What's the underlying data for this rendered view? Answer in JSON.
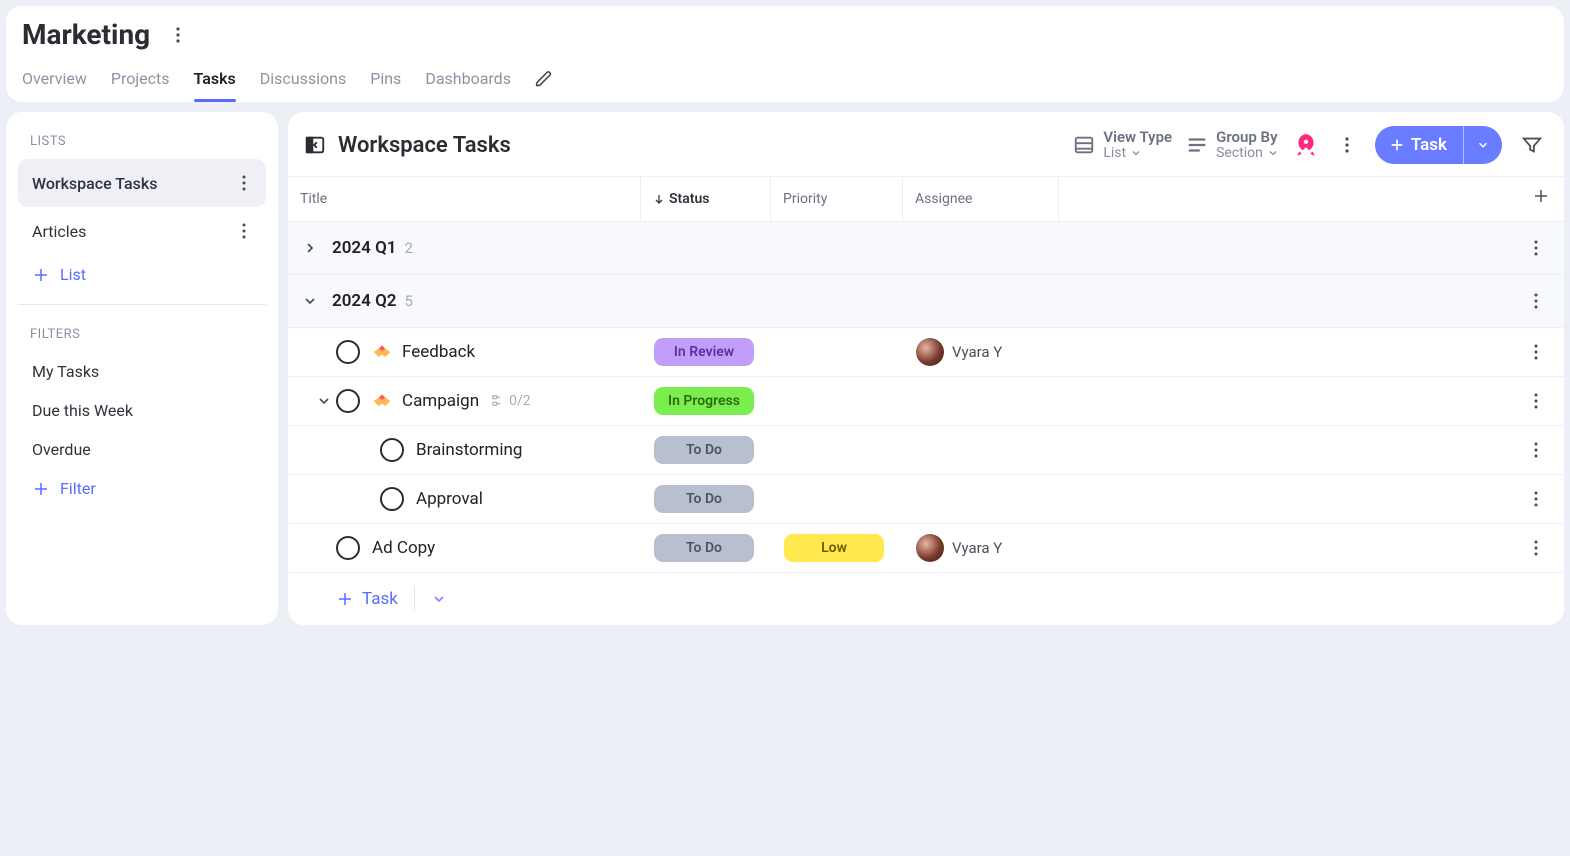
{
  "header": {
    "title": "Marketing",
    "tabs": [
      {
        "label": "Overview",
        "active": false
      },
      {
        "label": "Projects",
        "active": false
      },
      {
        "label": "Tasks",
        "active": true
      },
      {
        "label": "Discussions",
        "active": false
      },
      {
        "label": "Pins",
        "active": false
      },
      {
        "label": "Dashboards",
        "active": false
      }
    ]
  },
  "sidebar": {
    "lists_label": "LISTS",
    "lists": [
      {
        "label": "Workspace Tasks",
        "active": true
      },
      {
        "label": "Articles",
        "active": false
      }
    ],
    "add_list_label": "List",
    "filters_label": "FILTERS",
    "filters": [
      {
        "label": "My Tasks"
      },
      {
        "label": "Due this Week"
      },
      {
        "label": "Overdue"
      }
    ],
    "add_filter_label": "Filter"
  },
  "main": {
    "title": "Workspace Tasks",
    "view_type": {
      "label": "View Type",
      "value": "List"
    },
    "group_by": {
      "label": "Group By",
      "value": "Section"
    },
    "task_button_label": "Task",
    "columns": {
      "title": "Title",
      "status": "Status",
      "priority": "Priority",
      "assignee": "Assignee"
    },
    "sections": [
      {
        "title": "2024 Q1",
        "count": "2",
        "expanded": false
      },
      {
        "title": "2024 Q2",
        "count": "5",
        "expanded": true
      }
    ],
    "tasks": [
      {
        "title": "Feedback",
        "status": "In Review",
        "status_class": "in-review",
        "priority": "",
        "assignee": "Vyara Y",
        "has_emoji": true
      },
      {
        "title": "Campaign",
        "status": "In Progress",
        "status_class": "in-progress",
        "priority": "",
        "assignee": "",
        "has_emoji": true,
        "subtasks_ind": "0/2",
        "expanded": true
      },
      {
        "title": "Brainstorming",
        "status": "To Do",
        "status_class": "todo",
        "priority": "",
        "assignee": "",
        "subtask": true
      },
      {
        "title": "Approval",
        "status": "To Do",
        "status_class": "todo",
        "priority": "",
        "assignee": "",
        "subtask": true
      },
      {
        "title": "Ad Copy",
        "status": "To Do",
        "status_class": "todo",
        "priority": "Low",
        "priority_class": "low",
        "assignee": "Vyara Y"
      }
    ],
    "add_task_label": "Task"
  }
}
